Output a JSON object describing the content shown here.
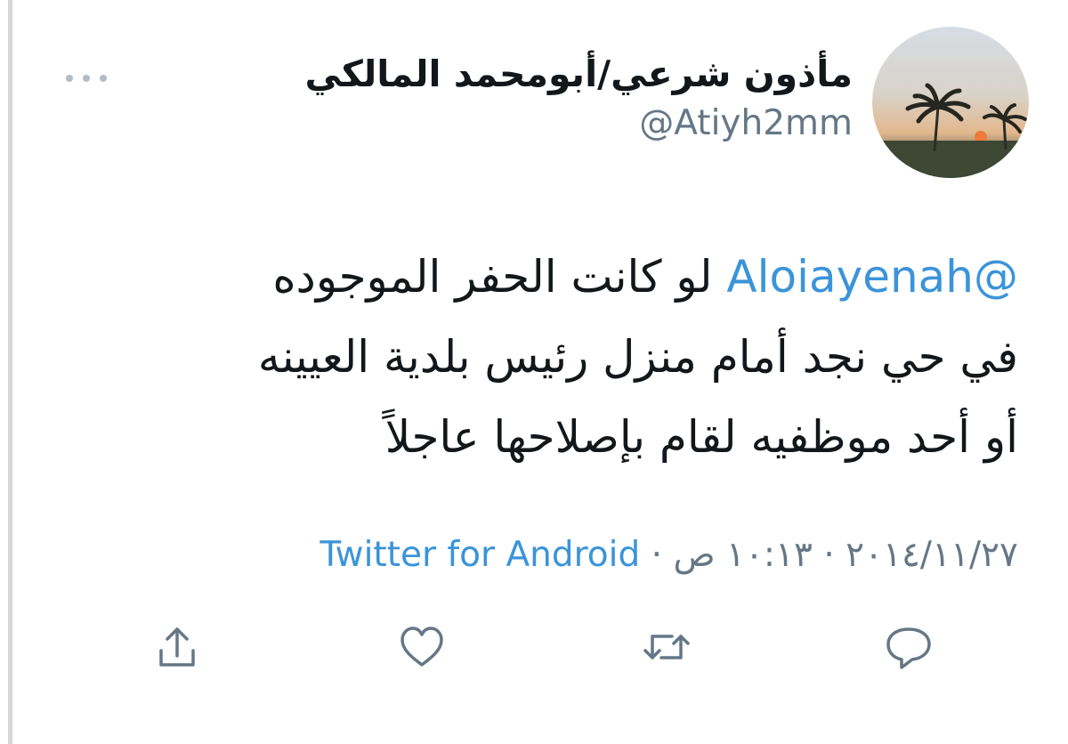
{
  "tweet": {
    "author": {
      "display_name": "مأذون شرعي/أبومحمد المالكي",
      "handle": "@Atiyh2mm",
      "avatar_icon": "palm-trees-sunset-avatar"
    },
    "text": {
      "mention": "@Aloiayenah",
      "line1": " لو كانت الحفر الموجوده",
      "line2": "في  حي نجد أمام منزل رئيس بلدية العيينه",
      "line3": "أو أحد موظفيه لقام بإصلاحها عاجلاً"
    },
    "meta": {
      "time": "١٠:١٣ ص",
      "separator": " · ",
      "date": "٢٠١٤/١١/٢٧",
      "source": "Twitter for Android"
    },
    "actions": {
      "reply_icon": "reply-icon",
      "retweet_icon": "retweet-icon",
      "like_icon": "heart-icon",
      "share_icon": "share-icon"
    },
    "more_icon": "more-options-icon"
  },
  "colors": {
    "text": "#14171a",
    "secondary": "#657786",
    "link": "#3b94d9",
    "divider": "#d4d6d9"
  }
}
